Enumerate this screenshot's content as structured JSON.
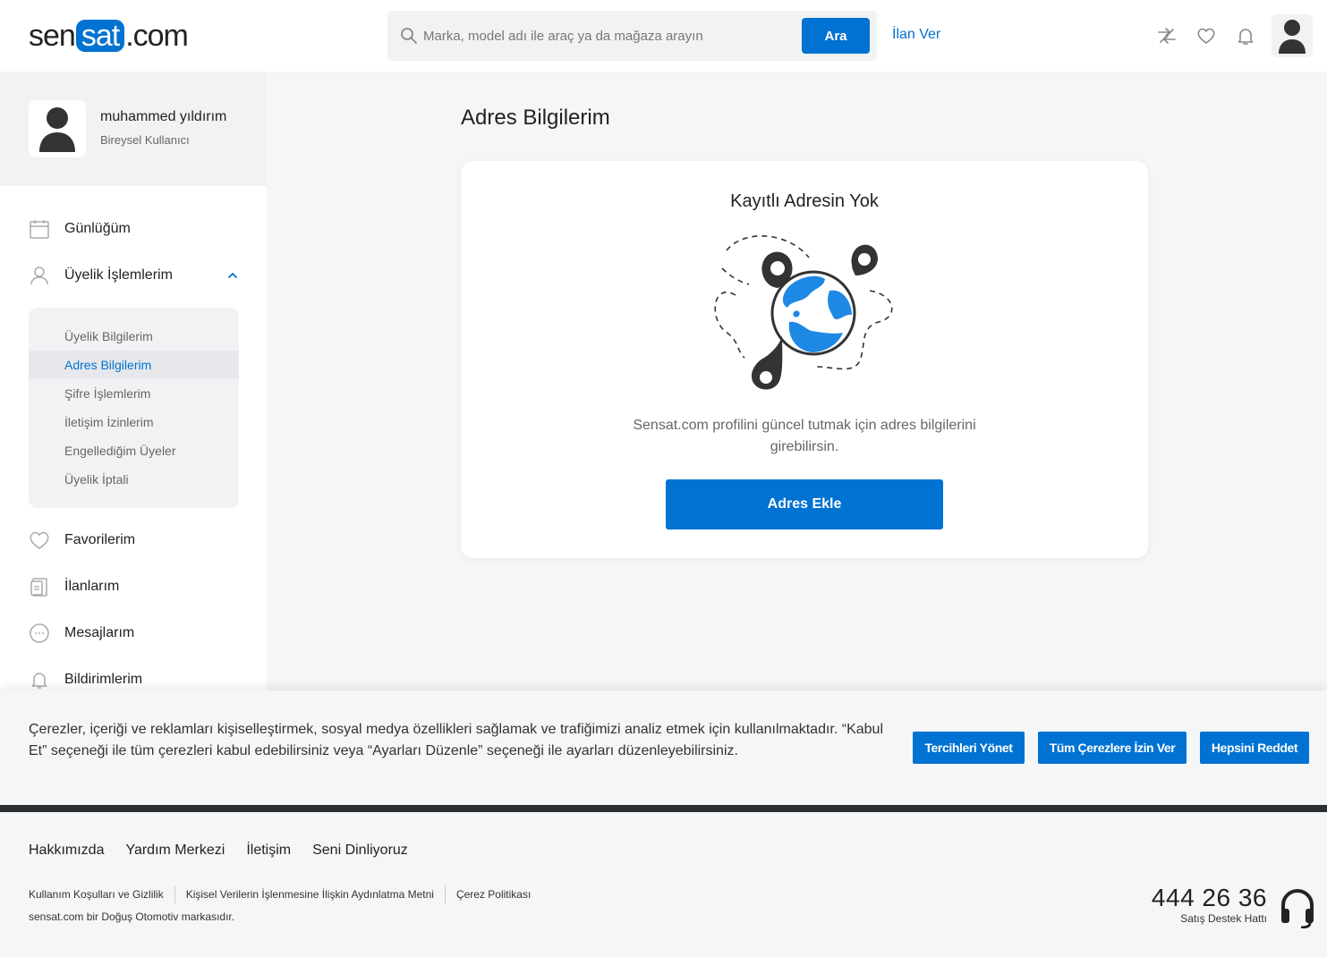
{
  "header": {
    "logo": {
      "pre": "sen",
      "mid": "sat",
      "post": ".com"
    },
    "search_placeholder": "Marka, model adı ile araç ya da mağaza arayın",
    "search_button": "Ara",
    "post_ad": "İlan Ver",
    "icons": [
      "compare-icon",
      "heart-icon",
      "bell-icon",
      "user-icon"
    ]
  },
  "profile": {
    "name": "muhammed yıldırım",
    "type": "Bireysel Kullanıcı"
  },
  "sidebar": {
    "items": [
      {
        "label": "Günlüğüm",
        "icon": "calendar-icon"
      },
      {
        "label": "Üyelik İşlemlerim",
        "icon": "user-icon",
        "expanded": true
      },
      {
        "label": "Favorilerim",
        "icon": "heart-icon"
      },
      {
        "label": "İlanlarım",
        "icon": "document-icon"
      },
      {
        "label": "Mesajlarım",
        "icon": "message-icon"
      },
      {
        "label": "Bildirimlerim",
        "icon": "bell-icon"
      }
    ],
    "submenu": [
      {
        "label": "Üyelik Bilgilerim"
      },
      {
        "label": "Adres Bilgilerim",
        "active": true
      },
      {
        "label": "Şifre İşlemlerim"
      },
      {
        "label": "İletişim İzinlerim"
      },
      {
        "label": "Engellediğim Üyeler"
      },
      {
        "label": "Üyelik İptali"
      }
    ]
  },
  "main": {
    "title": "Adres Bilgilerim",
    "card": {
      "title": "Kayıtlı Adresin Yok",
      "description": "Sensat.com profilini güncel tutmak için adres bilgilerini girebilirsin.",
      "button": "Adres Ekle"
    }
  },
  "cookie": {
    "text": "Çerezler, içeriği ve reklamları kişiselleştirmek, sosyal medya özellikleri sağlamak ve trafiğimizi analiz etmek için kullanılmaktadır. “Kabul Et” seçeneği ile tüm çerezleri kabul edebilirsiniz veya “Ayarları Düzenle” seçeneği ile ayarları düzenleyebilirsiniz.",
    "buttons": {
      "manage": "Tercihleri Yönet",
      "accept_all": "Tüm Çerezlere İzin Ver",
      "reject_all": "Hepsini Reddet"
    }
  },
  "footer": {
    "links": [
      "Hakkımızda",
      "Yardım Merkezi",
      "İletişim",
      "Seni Dinliyoruz"
    ],
    "legal": [
      "Kullanım Koşulları ve Gizlilik",
      "Kişisel Verilerin İşlenmesine İlişkin Aydınlatma Metni",
      "Çerez Politikası"
    ],
    "copyright": "sensat.com bir Doğuş Otomotiv markasıdır.",
    "phone": "444 26 36",
    "phone_label": "Satış Destek Hattı"
  },
  "colors": {
    "brand": "#0072d1",
    "dark": "#2b2f33"
  }
}
